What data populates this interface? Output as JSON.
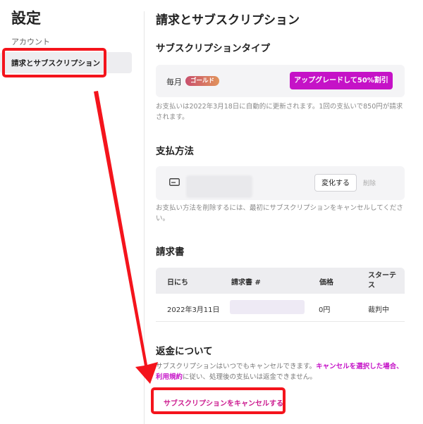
{
  "sidebar": {
    "title": "設定",
    "items": [
      {
        "label": "アカウント"
      },
      {
        "label": "請求とサブスクリプション"
      }
    ]
  },
  "main": {
    "title": "請求とサブスクリプション",
    "subscription": {
      "section_title": "サブスクリプションタイプ",
      "period": "毎月",
      "badge": "ゴールド",
      "upgrade_label": "アップグレードして50%割引",
      "note": "お支払いは2022年3月18日に自動的に更新されます。1回の支払いで850円が請求されます。"
    },
    "payment": {
      "section_title": "支払方法",
      "change_label": "変化する",
      "delete_label": "削除",
      "note": "お支払い方法を削除するには、最初にサブスクリプションをキャンセルしてください。"
    },
    "invoices": {
      "section_title": "請求書",
      "headers": [
        "日にち",
        "請求書 #",
        "価格",
        "スターテス"
      ],
      "rows": [
        {
          "date": "2022年3月11日",
          "price": "0円",
          "status": "裁判中"
        }
      ]
    },
    "refund": {
      "section_title": "返金について",
      "text_before": "サブスクリプションはいつでもキャンセルできます。",
      "link1": "キャンセルを選択した場合、",
      "link2": "利用規約",
      "text_after": "に従い、処理後の支払いは返金できません。",
      "cancel_label": "サブスクリプションをキャンセルする"
    }
  },
  "colors": {
    "accent": "#c512c7",
    "highlight_red": "#f4141c",
    "sidebar_active_bg": "#ededf0"
  }
}
